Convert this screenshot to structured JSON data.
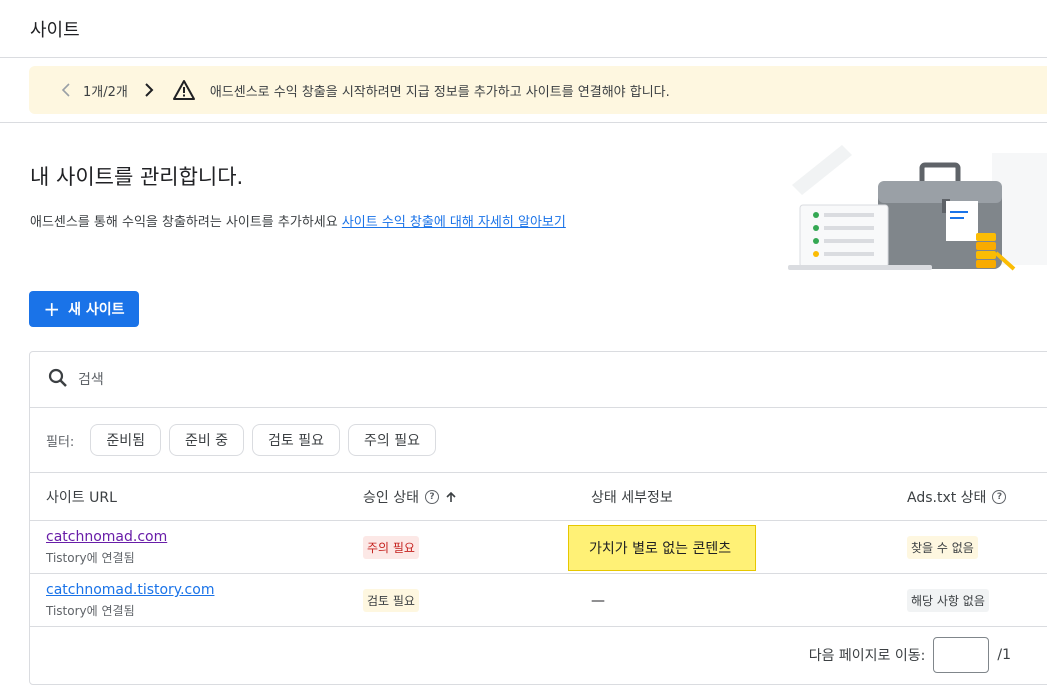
{
  "header": {
    "title": "사이트"
  },
  "banner": {
    "pager": "1개/2개",
    "message": "애드센스로 수익 창출을 시작하려면 지급 정보를 추가하고 사이트를 연결해야 합니다."
  },
  "hero": {
    "title": "내 사이트를 관리합니다.",
    "description": "애드센스를 통해 수익을 창출하려는 사이트를 추가하세요",
    "link": "사이트 수익 창출에 대해 자세히 알아보기"
  },
  "new_site_label": "새 사이트",
  "search": {
    "placeholder": "검색"
  },
  "filters": {
    "label": "필터:",
    "chips": [
      "준비됨",
      "준비 중",
      "검토 필요",
      "주의 필요"
    ]
  },
  "table": {
    "headers": {
      "site_url": "사이트 URL",
      "approval": "승인 상태",
      "details": "상태 세부정보",
      "ads_txt": "Ads.txt 상태"
    },
    "rows": [
      {
        "url": "catchnomad.com",
        "sub": "Tistory에 연결됨",
        "approval": "주의 필요",
        "details": "가치가 별로 없는 콘텐츠",
        "ads_txt": "찾을 수 없음"
      },
      {
        "url": "catchnomad.tistory.com",
        "sub": "Tistory에 연결됨",
        "approval": "검토 필요",
        "details": "—",
        "ads_txt": "해당 사항 없음"
      }
    ]
  },
  "pagination": {
    "label": "다음 페이지로 이동:",
    "total": "/1"
  }
}
